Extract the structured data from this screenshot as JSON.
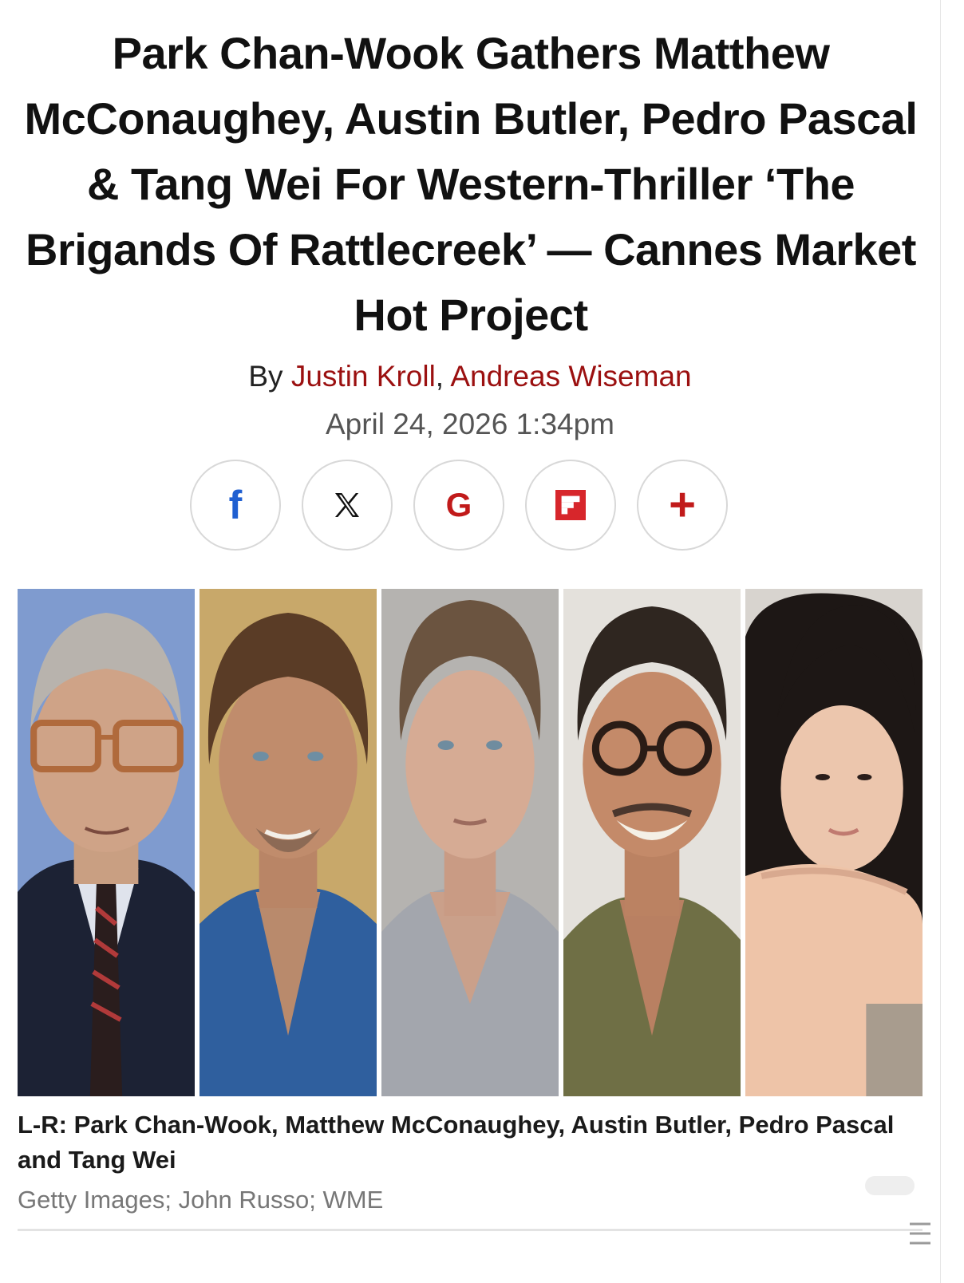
{
  "article": {
    "headline": "Park Chan-Wook Gathers Matthew McConaughey, Austin Butler, Pedro Pascal & Tang Wei For Western-Thriller ‘The Brigands Of Rattlecreek’ — Cannes Market Hot Project",
    "byline_prefix": "By ",
    "authors": [
      "Justin Kroll",
      "Andreas Wiseman"
    ],
    "author_separator": ", ",
    "date": "April 24, 2026 1:34pm"
  },
  "share": {
    "facebook": "f",
    "x": "𝕏",
    "google": "G",
    "flipboard": "flipboard-icon",
    "more": "+"
  },
  "image": {
    "portraits": [
      "Park Chan-Wook",
      "Matthew McConaughey",
      "Austin Butler",
      "Pedro Pascal",
      "Tang Wei"
    ],
    "caption": "L-R: Park Chan-Wook, Matthew McConaughey, Austin Butler, Pedro Pascal and Tang Wei",
    "credit": "Getty Images; John Russo; WME"
  },
  "colors": {
    "author_link": "#9b1010",
    "accent_red": "#c11a1a",
    "facebook_blue": "#1f5fd1"
  }
}
